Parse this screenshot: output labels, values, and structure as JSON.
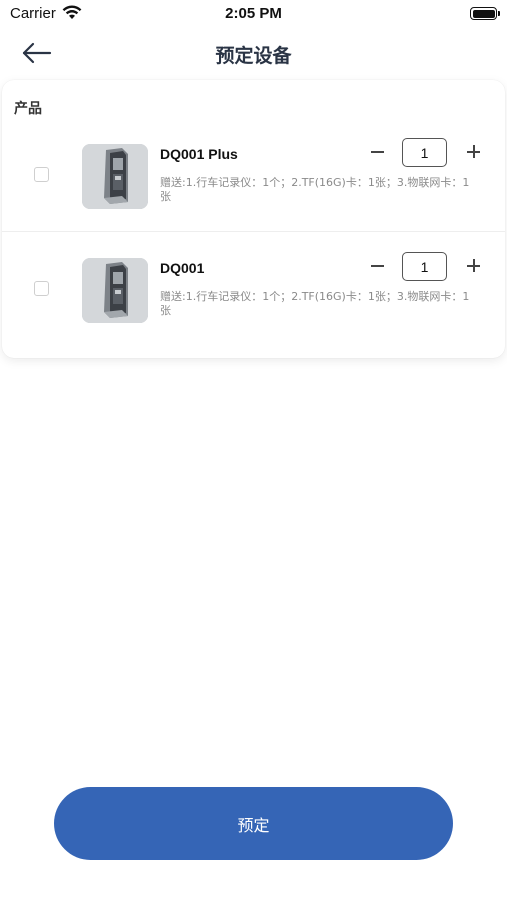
{
  "status_bar": {
    "carrier": "Carrier",
    "time": "2:05 PM"
  },
  "nav": {
    "title": "预定设备",
    "back_icon": "arrow-left-icon"
  },
  "card": {
    "section_label": "产品",
    "products": [
      {
        "name": "DQ001 Plus",
        "gift_text": "赠送:1.行车记录仪：1个；2.TF(16G)卡：1张；3.物联网卡：1张",
        "quantity": "1",
        "checked": false,
        "image_icon": "device-image"
      },
      {
        "name": "DQ001",
        "gift_text": "赠送:1.行车记录仪：1个；2.TF(16G)卡：1张；3.物联网卡：1张",
        "quantity": "1",
        "checked": false,
        "image_icon": "device-image"
      }
    ]
  },
  "order_button": {
    "label": "预定"
  },
  "colors": {
    "accent": "#3565b6",
    "title": "#2a3445",
    "secondary_text": "#8a8a8a"
  }
}
